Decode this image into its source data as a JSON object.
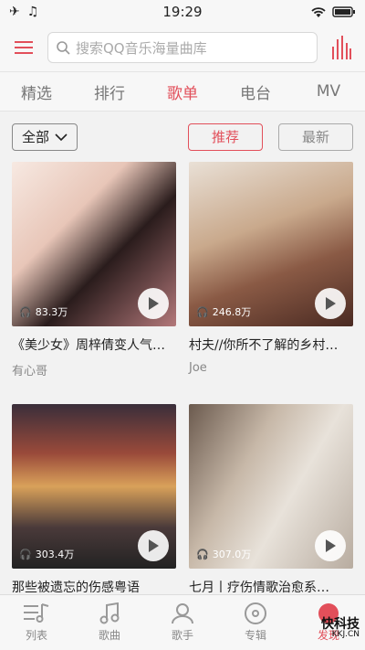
{
  "status_bar": {
    "time": "19:29",
    "left_icons": [
      "airplane-icon",
      "music-note-icon"
    ],
    "right_icons": [
      "wifi-icon",
      "battery-icon"
    ]
  },
  "search": {
    "placeholder": "搜索QQ音乐海量曲库"
  },
  "tabs": [
    {
      "label": "精选",
      "active": false
    },
    {
      "label": "排行",
      "active": false
    },
    {
      "label": "歌单",
      "active": true
    },
    {
      "label": "电台",
      "active": false
    },
    {
      "label": "MV",
      "active": false
    }
  ],
  "filter": {
    "dropdown_value": "全部",
    "sort_recommend": "推荐",
    "sort_latest": "最新",
    "active_sort": "推荐"
  },
  "playlists": [
    {
      "title": "《美少女》周梓倩变人气…",
      "author": "有心哥",
      "plays": "83.3万"
    },
    {
      "title": "村夫//你所不了解的乡村…",
      "author": "Joe",
      "plays": "246.8万"
    },
    {
      "title": "那些被遗忘的伤感粤语",
      "author": "",
      "plays": "303.4万"
    },
    {
      "title": "七月丨疗伤情歌治愈系…",
      "author": "",
      "plays": "307.0万"
    }
  ],
  "bottom_nav": [
    {
      "label": "列表",
      "icon": "playlist-icon",
      "active": false
    },
    {
      "label": "歌曲",
      "icon": "music-note-icon",
      "active": false
    },
    {
      "label": "歌手",
      "icon": "singer-icon",
      "active": false
    },
    {
      "label": "专辑",
      "icon": "album-disc-icon",
      "active": false
    },
    {
      "label": "发现",
      "icon": "discover-dot-icon",
      "active": true
    }
  ],
  "watermark": {
    "text": "快科技",
    "subtext": "KKJ.CN"
  },
  "colors": {
    "accent": "#e24f5a",
    "background": "#f2f2f2"
  }
}
